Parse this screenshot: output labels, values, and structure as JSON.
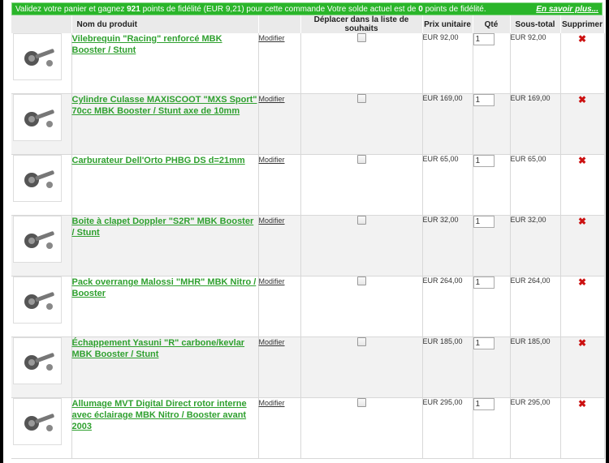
{
  "banner": {
    "text_before": "Validez votre panier et gagnez ",
    "points": "921",
    "text_middle": " points de fidélité (EUR 9,21) pour cette commande Votre solde actuel est de ",
    "balance": "0",
    "text_after": " points de fidélité.",
    "more_link": "En savoir plus..."
  },
  "columns": {
    "name": "Nom du produit",
    "wishlist": "Déplacer dans la liste de souhaits",
    "unit_price": "Prix unitaire",
    "qty": "Qté",
    "subtotal": "Sous-total",
    "delete": "Supprimer"
  },
  "items": [
    {
      "name": "Vilebrequin \"Racing\" renforcé MBK Booster / Stunt",
      "modify": "Modifier",
      "price": "EUR 92,00",
      "qty": "1",
      "subtotal": "EUR 92,00",
      "delete": "✖"
    },
    {
      "name": "Cylindre Culasse MAXISCOOT \"MXS Sport\" 70cc MBK Booster / Stunt axe de 10mm",
      "modify": "Modifier",
      "price": "EUR 169,00",
      "qty": "1",
      "subtotal": "EUR 169,00",
      "delete": "✖"
    },
    {
      "name": "Carburateur Dell'Orto PHBG DS d=21mm",
      "modify": "Modifier",
      "price": "EUR 65,00",
      "qty": "1",
      "subtotal": "EUR 65,00",
      "delete": "✖"
    },
    {
      "name": "Boite à clapet Doppler \"S2R\" MBK Booster / Stunt",
      "modify": "Modifier",
      "price": "EUR 32,00",
      "qty": "1",
      "subtotal": "EUR 32,00",
      "delete": "✖"
    },
    {
      "name": "Pack overrange Malossi \"MHR\" MBK Nitro / Booster",
      "modify": "Modifier",
      "price": "EUR 264,00",
      "qty": "1",
      "subtotal": "EUR 264,00",
      "delete": "✖"
    },
    {
      "name": "Échappement Yasuni \"R\" carbone/kevlar MBK Booster / Stunt",
      "modify": "Modifier",
      "price": "EUR 185,00",
      "qty": "1",
      "subtotal": "EUR 185,00",
      "delete": "✖"
    },
    {
      "name": "Allumage MVT Digital Direct rotor interne avec éclairage MBK Nitro / Booster avant 2003",
      "modify": "Modifier",
      "price": "EUR 295,00",
      "qty": "1",
      "subtotal": "EUR 295,00",
      "delete": "✖"
    }
  ]
}
